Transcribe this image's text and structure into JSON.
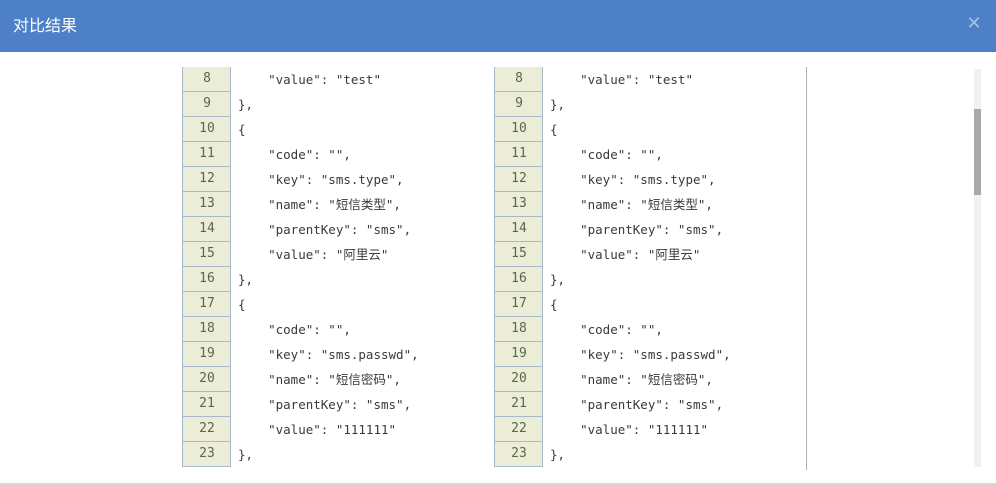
{
  "dialog": {
    "title": "对比结果",
    "close_icon": "close-icon"
  },
  "left_pane": {
    "lines": [
      {
        "num": "8",
        "text": "    \"value\": \"test\""
      },
      {
        "num": "9",
        "text": "},"
      },
      {
        "num": "10",
        "text": "{"
      },
      {
        "num": "11",
        "text": "    \"code\": \"\","
      },
      {
        "num": "12",
        "text": "    \"key\": \"sms.type\","
      },
      {
        "num": "13",
        "text": "    \"name\": \"短信类型\","
      },
      {
        "num": "14",
        "text": "    \"parentKey\": \"sms\","
      },
      {
        "num": "15",
        "text": "    \"value\": \"阿里云\""
      },
      {
        "num": "16",
        "text": "},"
      },
      {
        "num": "17",
        "text": "{"
      },
      {
        "num": "18",
        "text": "    \"code\": \"\","
      },
      {
        "num": "19",
        "text": "    \"key\": \"sms.passwd\","
      },
      {
        "num": "20",
        "text": "    \"name\": \"短信密码\","
      },
      {
        "num": "21",
        "text": "    \"parentKey\": \"sms\","
      },
      {
        "num": "22",
        "text": "    \"value\": \"111111\""
      },
      {
        "num": "23",
        "text": "},"
      }
    ]
  },
  "right_pane": {
    "lines": [
      {
        "num": "8",
        "text": "    \"value\": \"test\""
      },
      {
        "num": "9",
        "text": "},"
      },
      {
        "num": "10",
        "text": "{"
      },
      {
        "num": "11",
        "text": "    \"code\": \"\","
      },
      {
        "num": "12",
        "text": "    \"key\": \"sms.type\","
      },
      {
        "num": "13",
        "text": "    \"name\": \"短信类型\","
      },
      {
        "num": "14",
        "text": "    \"parentKey\": \"sms\","
      },
      {
        "num": "15",
        "text": "    \"value\": \"阿里云\""
      },
      {
        "num": "16",
        "text": "},"
      },
      {
        "num": "17",
        "text": "{"
      },
      {
        "num": "18",
        "text": "    \"code\": \"\","
      },
      {
        "num": "19",
        "text": "    \"key\": \"sms.passwd\","
      },
      {
        "num": "20",
        "text": "    \"name\": \"短信密码\","
      },
      {
        "num": "21",
        "text": "    \"parentKey\": \"sms\","
      },
      {
        "num": "22",
        "text": "    \"value\": \"111111\""
      },
      {
        "num": "23",
        "text": "},"
      }
    ]
  },
  "colors": {
    "titlebar": "#4e80c7",
    "gutter": "#ebedd9",
    "gutter_text": "#586a44"
  }
}
